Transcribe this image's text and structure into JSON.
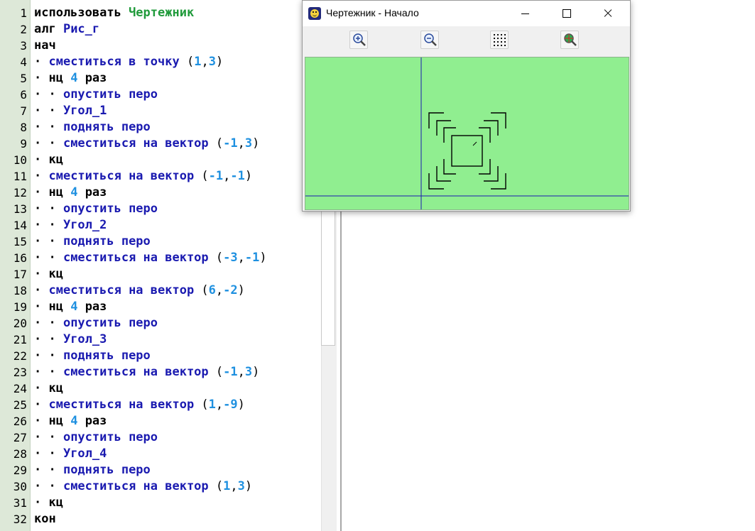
{
  "editor": {
    "lines": [
      {
        "n": "1",
        "p": [
          [
            "k",
            "использовать "
          ],
          [
            "g",
            "Чертежник"
          ]
        ]
      },
      {
        "n": "2",
        "p": [
          [
            "k",
            "алг "
          ],
          [
            "a",
            "Рис_г"
          ]
        ]
      },
      {
        "n": "3",
        "p": [
          [
            "k",
            "нач"
          ]
        ]
      },
      {
        "n": "4",
        "p": [
          [
            "dot",
            "· "
          ],
          [
            "a",
            "сместиться в точку "
          ],
          [
            "p",
            "("
          ],
          [
            "n",
            "1"
          ],
          [
            "p",
            ","
          ],
          [
            "n",
            "3"
          ],
          [
            "p",
            ")"
          ]
        ]
      },
      {
        "n": "5",
        "p": [
          [
            "dot",
            "· "
          ],
          [
            "k",
            "нц "
          ],
          [
            "n",
            "4"
          ],
          [
            "k",
            " раз"
          ]
        ]
      },
      {
        "n": "6",
        "p": [
          [
            "dot",
            "· · "
          ],
          [
            "a",
            "опустить перо"
          ]
        ]
      },
      {
        "n": "7",
        "p": [
          [
            "dot",
            "· · "
          ],
          [
            "a",
            "Угол_1"
          ]
        ]
      },
      {
        "n": "8",
        "p": [
          [
            "dot",
            "· · "
          ],
          [
            "a",
            "поднять перо"
          ]
        ]
      },
      {
        "n": "9",
        "p": [
          [
            "dot",
            "· · "
          ],
          [
            "a",
            "сместиться на вектор "
          ],
          [
            "p",
            "("
          ],
          [
            "n",
            "-1"
          ],
          [
            "p",
            ","
          ],
          [
            "n",
            "3"
          ],
          [
            "p",
            ")"
          ]
        ]
      },
      {
        "n": "10",
        "p": [
          [
            "dot",
            "· "
          ],
          [
            "k",
            "кц"
          ]
        ]
      },
      {
        "n": "11",
        "p": [
          [
            "dot",
            "· "
          ],
          [
            "a",
            "сместиться на вектор "
          ],
          [
            "p",
            "("
          ],
          [
            "n",
            "-1"
          ],
          [
            "p",
            ","
          ],
          [
            "n",
            "-1"
          ],
          [
            "p",
            ")"
          ]
        ]
      },
      {
        "n": "12",
        "p": [
          [
            "dot",
            "· "
          ],
          [
            "k",
            "нц "
          ],
          [
            "n",
            "4"
          ],
          [
            "k",
            " раз"
          ]
        ]
      },
      {
        "n": "13",
        "p": [
          [
            "dot",
            "· · "
          ],
          [
            "a",
            "опустить перо"
          ]
        ]
      },
      {
        "n": "14",
        "p": [
          [
            "dot",
            "· · "
          ],
          [
            "a",
            "Угол_2"
          ]
        ]
      },
      {
        "n": "15",
        "p": [
          [
            "dot",
            "· · "
          ],
          [
            "a",
            "поднять перо"
          ]
        ]
      },
      {
        "n": "16",
        "p": [
          [
            "dot",
            "· · "
          ],
          [
            "a",
            "сместиться на вектор "
          ],
          [
            "p",
            "("
          ],
          [
            "n",
            "-3"
          ],
          [
            "p",
            ","
          ],
          [
            "n",
            "-1"
          ],
          [
            "p",
            ")"
          ]
        ]
      },
      {
        "n": "17",
        "p": [
          [
            "dot",
            "· "
          ],
          [
            "k",
            "кц"
          ]
        ]
      },
      {
        "n": "18",
        "p": [
          [
            "dot",
            "· "
          ],
          [
            "a",
            "сместиться на вектор "
          ],
          [
            "p",
            "("
          ],
          [
            "n",
            "6"
          ],
          [
            "p",
            ","
          ],
          [
            "n",
            "-2"
          ],
          [
            "p",
            ")"
          ]
        ]
      },
      {
        "n": "19",
        "p": [
          [
            "dot",
            "· "
          ],
          [
            "k",
            "нц "
          ],
          [
            "n",
            "4"
          ],
          [
            "k",
            " раз"
          ]
        ]
      },
      {
        "n": "20",
        "p": [
          [
            "dot",
            "· · "
          ],
          [
            "a",
            "опустить перо"
          ]
        ]
      },
      {
        "n": "21",
        "p": [
          [
            "dot",
            "· · "
          ],
          [
            "a",
            "Угол_3"
          ]
        ]
      },
      {
        "n": "22",
        "p": [
          [
            "dot",
            "· · "
          ],
          [
            "a",
            "поднять перо"
          ]
        ]
      },
      {
        "n": "23",
        "p": [
          [
            "dot",
            "· · "
          ],
          [
            "a",
            "сместиться на вектор "
          ],
          [
            "p",
            "("
          ],
          [
            "n",
            "-1"
          ],
          [
            "p",
            ","
          ],
          [
            "n",
            "3"
          ],
          [
            "p",
            ")"
          ]
        ]
      },
      {
        "n": "24",
        "p": [
          [
            "dot",
            "· "
          ],
          [
            "k",
            "кц"
          ]
        ]
      },
      {
        "n": "25",
        "p": [
          [
            "dot",
            "· "
          ],
          [
            "a",
            "сместиться на вектор "
          ],
          [
            "p",
            "("
          ],
          [
            "n",
            "1"
          ],
          [
            "p",
            ","
          ],
          [
            "n",
            "-9"
          ],
          [
            "p",
            ")"
          ]
        ]
      },
      {
        "n": "26",
        "p": [
          [
            "dot",
            "· "
          ],
          [
            "k",
            "нц "
          ],
          [
            "n",
            "4"
          ],
          [
            "k",
            " раз"
          ]
        ]
      },
      {
        "n": "27",
        "p": [
          [
            "dot",
            "· · "
          ],
          [
            "a",
            "опустить перо"
          ]
        ]
      },
      {
        "n": "28",
        "p": [
          [
            "dot",
            "· · "
          ],
          [
            "a",
            "Угол_4"
          ]
        ]
      },
      {
        "n": "29",
        "p": [
          [
            "dot",
            "· · "
          ],
          [
            "a",
            "поднять перо"
          ]
        ]
      },
      {
        "n": "30",
        "p": [
          [
            "dot",
            "· · "
          ],
          [
            "a",
            "сместиться на вектор "
          ],
          [
            "p",
            "("
          ],
          [
            "n",
            "1"
          ],
          [
            "p",
            ","
          ],
          [
            "n",
            "3"
          ],
          [
            "p",
            ")"
          ]
        ]
      },
      {
        "n": "31",
        "p": [
          [
            "dot",
            "· "
          ],
          [
            "k",
            "кц"
          ]
        ]
      },
      {
        "n": "32",
        "p": [
          [
            "k",
            "кон"
          ]
        ]
      }
    ]
  },
  "drawer_window": {
    "title": "Чертежник - Начало",
    "toolbar": [
      "zoom-in-icon",
      "zoom-out-icon",
      "grid-icon",
      "fit-to-view-icon"
    ],
    "canvas_color": "#90ee90",
    "axis_color": "#1a1ab0"
  }
}
